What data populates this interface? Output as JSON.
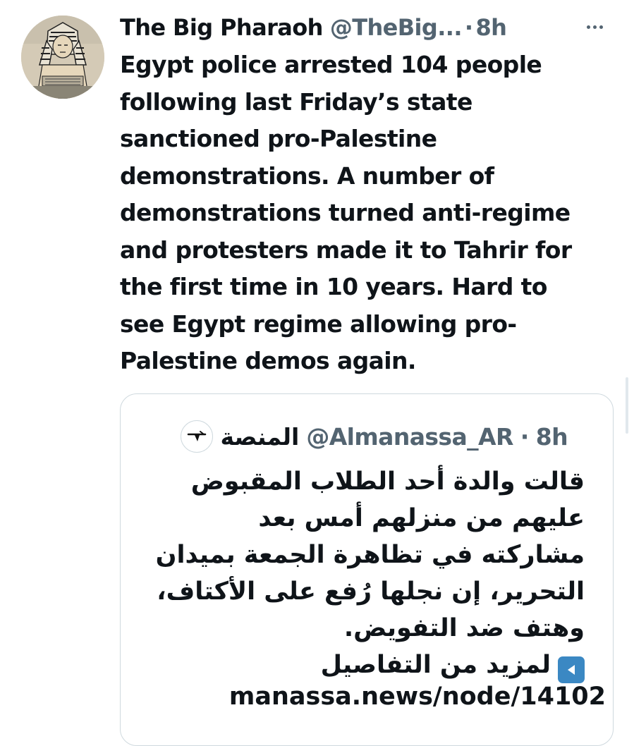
{
  "tweet": {
    "author_name": "The Big Pharaoh",
    "author_handle": "@TheBig...",
    "separator": "·",
    "time": "8h",
    "text": "Egypt police arrested 104 people\nfollowing last Friday’s state\nsanctioned pro-Palestine\ndemonstrations. A number of\ndemonstrations turned anti-regime\nand protesters made it to Tahrir for\nthe first time in 10 years. Hard to\nsee Egypt regime allowing pro-\nPalestine demos again."
  },
  "quote": {
    "author_name": "المنصة",
    "author_handle": "@Almanassa_AR",
    "separator": "·",
    "time": "8h",
    "text": "قالت والدة أحد الطلاب المقبوض\nعليهم من منزلهم أمس بعد\nمشاركته في تظاهرة الجمعة بميدان\nالتحرير، إن نجلها رُفع على الأكتاف،\nوهتف ضد التفويض.",
    "more_label": "لمزيد من التفاصيل",
    "link": "manassa.news/node/14102"
  },
  "icons": {
    "more": "more-horizontal-icon",
    "avatar": "pharaoh-avatar",
    "quote_avatar": "almanassa-logo",
    "arrow": "left-arrow-button-emoji"
  },
  "colors": {
    "text": "#0f1419",
    "secondary": "#536471",
    "border": "#cfd9de",
    "emoji_blue": "#3b88c3"
  }
}
